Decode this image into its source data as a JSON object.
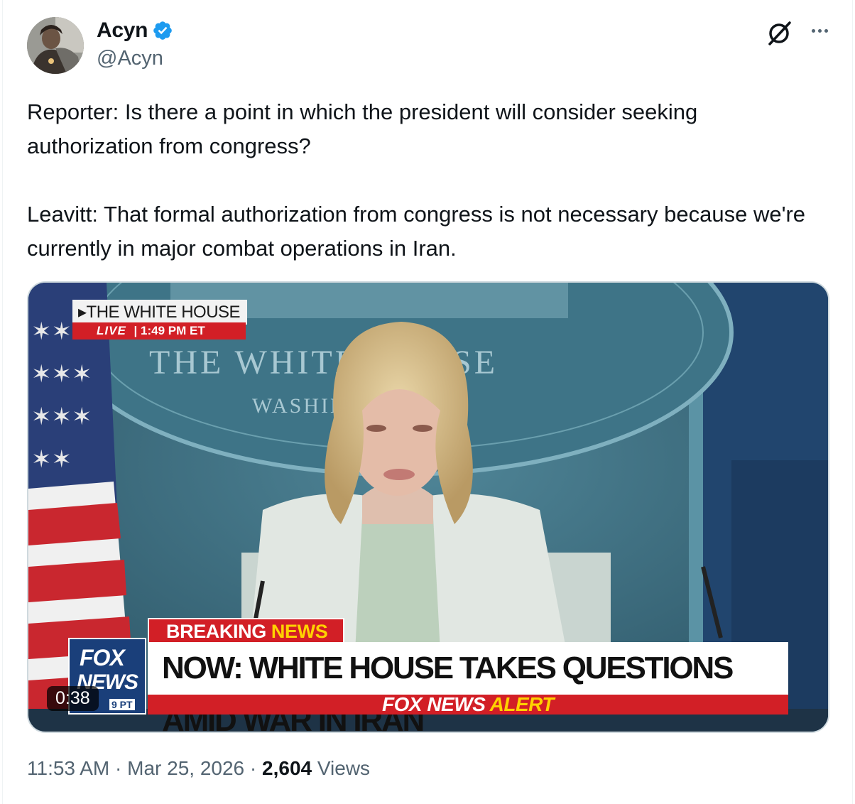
{
  "author": {
    "display_name": "Acyn",
    "handle": "@Acyn",
    "verified": true,
    "avatar_icon": "avatar-photo"
  },
  "actions": {
    "grok_icon": "grok-icon",
    "more_icon": "more-icon"
  },
  "tweet": {
    "paragraphs": [
      "Reporter: Is there a point in which the president will consider seeking authorization from congress?",
      "Leavitt: That formal authorization from congress is not necessary because we're currently in major combat operations in Iran."
    ]
  },
  "video": {
    "duration": "0:38",
    "overlay": {
      "location_label": "▸THE WHITE HOUSE",
      "live_label": "LIVE",
      "live_time": "| 1:49 PM ET",
      "breaking_prefix": "BREAKING ",
      "breaking_suffix": "NEWS",
      "headline": "NOW: WHITE HOUSE TAKES QUESTIONS AMID WAR IN IRAN",
      "alert_prefix": "FOX NEWS ",
      "alert_suffix": "ALERT",
      "logo_line1": "FOX",
      "logo_line2": "NEWS",
      "logo_time": "9 PT",
      "seal_text": "THE WHITE HOUSE",
      "seal_subtext": "WASHINGTON"
    }
  },
  "meta": {
    "time": "11:53 AM",
    "separator1": " · ",
    "date": "Mar 25, 2026",
    "separator2": " · ",
    "views_count": "2,604",
    "views_label": " Views"
  },
  "colors": {
    "verified_blue": "#1d9bf0",
    "fox_red": "#d21f26",
    "fox_blue": "#1a3f7a",
    "fox_yellow": "#ffd200",
    "secondary_text": "#536471"
  }
}
